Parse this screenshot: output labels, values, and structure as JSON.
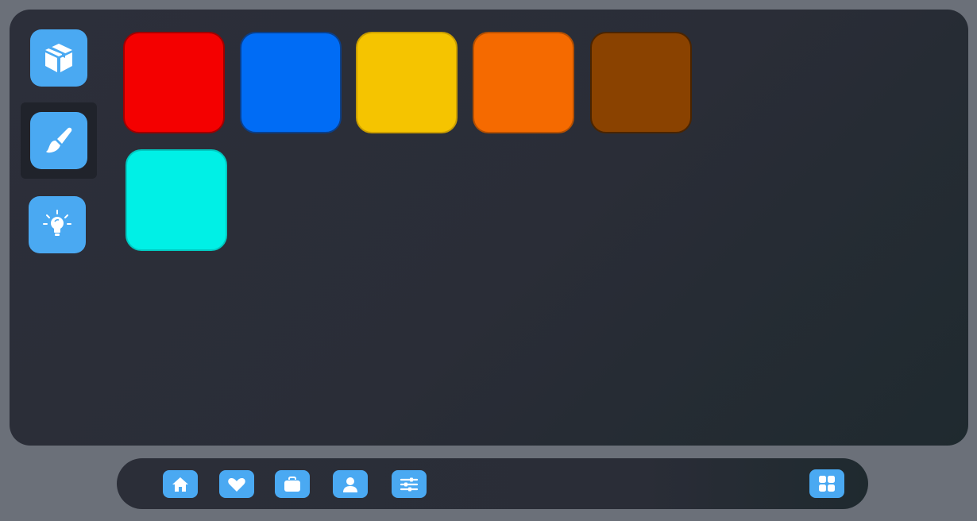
{
  "sidebar": {
    "items": [
      {
        "name": "box",
        "icon": "box-icon",
        "selected": false
      },
      {
        "name": "brush",
        "icon": "paint-brush-icon",
        "selected": true
      },
      {
        "name": "ideas",
        "icon": "lightbulb-icon",
        "selected": false
      }
    ]
  },
  "palette": {
    "swatches": [
      {
        "color": "#f40000",
        "border": "#9e0000"
      },
      {
        "color": "#006cf5",
        "border": "#0a3f8a"
      },
      {
        "color": "#f5c400",
        "border": "#c99d00"
      },
      {
        "color": "#f56a00",
        "border": "#b44f00"
      },
      {
        "color": "#8a4200",
        "border": "#4a2400"
      },
      {
        "color": "#00f0e6",
        "border": "#00c8c0"
      }
    ]
  },
  "bottom_nav": {
    "items": [
      {
        "icon": "home-icon"
      },
      {
        "icon": "heart-icon"
      },
      {
        "icon": "briefcase-icon"
      },
      {
        "icon": "user-icon"
      },
      {
        "icon": "sliders-icon"
      },
      {
        "icon": "grid-icon"
      }
    ]
  },
  "colors": {
    "accent": "#4aa9f2",
    "panel": "#2a2d37",
    "frame": "#6b7079"
  }
}
